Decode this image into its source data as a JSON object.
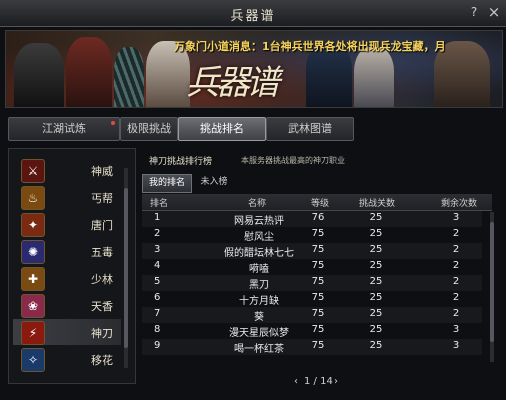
{
  "window": {
    "title": "兵器谱",
    "help": "?",
    "close": "×"
  },
  "banner": {
    "notice": "万象门小道消息：1台神兵世界各处将出现兵龙宝藏，月",
    "calligraphy": "兵器谱"
  },
  "tabs": [
    {
      "label": "江湖试炼"
    },
    {
      "label": "极限挑战"
    },
    {
      "label": "挑战排名"
    },
    {
      "label": "武林图谱"
    }
  ],
  "sidebar": {
    "items": [
      {
        "label": "神威",
        "icon": "shenwei-icon"
      },
      {
        "label": "丐帮",
        "icon": "gaibang-icon"
      },
      {
        "label": "唐门",
        "icon": "tangmen-icon"
      },
      {
        "label": "五毒",
        "icon": "wudu-icon"
      },
      {
        "label": "少林",
        "icon": "shaolin-icon"
      },
      {
        "label": "天香",
        "icon": "tianxiang-icon"
      },
      {
        "label": "神刀",
        "icon": "shendao-icon"
      },
      {
        "label": "移花",
        "icon": "yihua-icon"
      }
    ]
  },
  "ranking": {
    "title": "神刀挑战排行榜",
    "description": "本服务器挑战最高的神刀职业",
    "subtab_mine": "我的排名",
    "subtab_unranked": "未入榜",
    "headers": {
      "rank": "排名",
      "name": "名称",
      "level": "等级",
      "wins": "挑战关数",
      "remaining": "剩余次数"
    },
    "rows": [
      {
        "rank": "1",
        "name": "网易云热评",
        "level": "76",
        "wins": "25",
        "remaining": "3"
      },
      {
        "rank": "2",
        "name": "慰风尘",
        "level": "75",
        "wins": "25",
        "remaining": "2"
      },
      {
        "rank": "3",
        "name": "假的醋坛林七七",
        "level": "75",
        "wins": "25",
        "remaining": "2"
      },
      {
        "rank": "4",
        "name": "嗬嗑",
        "level": "75",
        "wins": "25",
        "remaining": "2"
      },
      {
        "rank": "5",
        "name": "黑刀",
        "level": "75",
        "wins": "25",
        "remaining": "2"
      },
      {
        "rank": "6",
        "name": "十方月缺",
        "level": "75",
        "wins": "25",
        "remaining": "2"
      },
      {
        "rank": "7",
        "name": "葵",
        "level": "75",
        "wins": "25",
        "remaining": "2"
      },
      {
        "rank": "8",
        "name": "漫天星辰似梦",
        "level": "75",
        "wins": "25",
        "remaining": "3"
      },
      {
        "rank": "9",
        "name": "喝一杯红茶",
        "level": "75",
        "wins": "25",
        "remaining": "3"
      }
    ]
  },
  "pager": {
    "prev": "‹",
    "page": "1 / 14",
    "next": "›"
  },
  "colors": {
    "accent": "#f7d35a",
    "notify_dot": "#e34a3a"
  }
}
